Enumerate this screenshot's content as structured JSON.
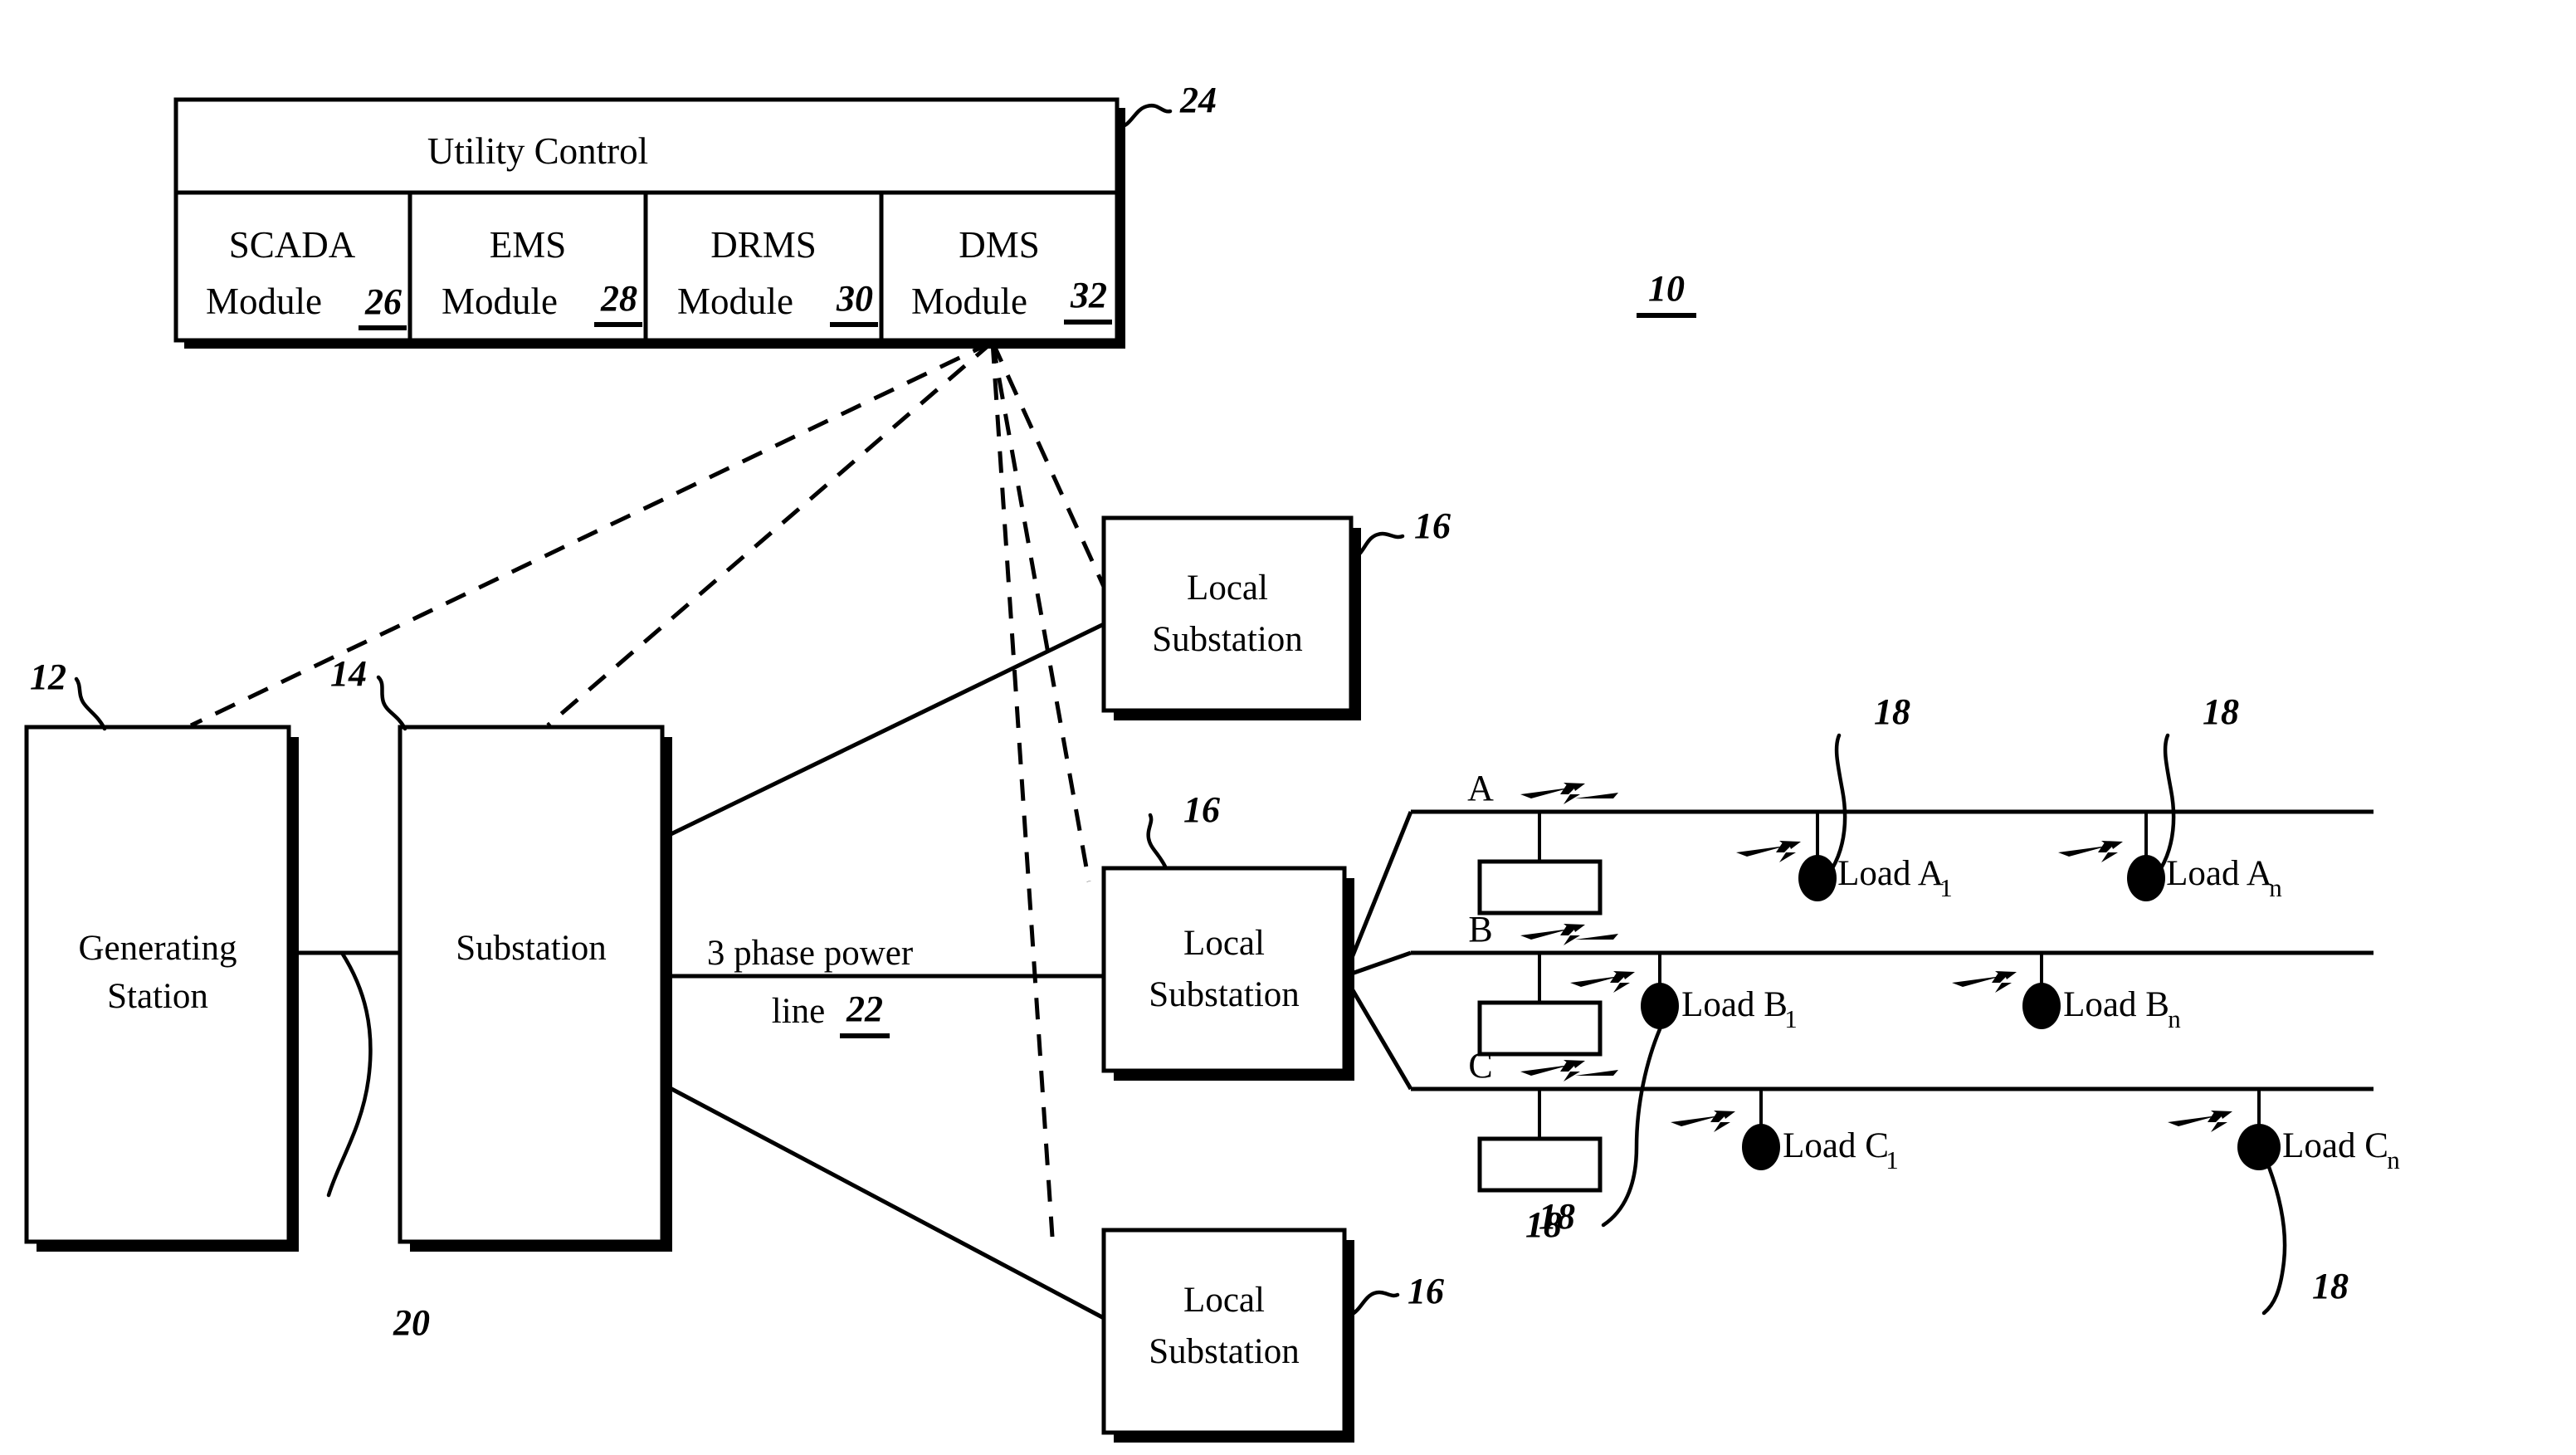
{
  "figure": {
    "figure_number_label": "10",
    "utility_control": {
      "title": "Utility Control",
      "ref": "24",
      "modules": [
        {
          "name": "SCADA",
          "sub": "Module",
          "ref": "26"
        },
        {
          "name": "EMS",
          "sub": "Module",
          "ref": "28"
        },
        {
          "name": "DRMS",
          "sub": "Module",
          "ref": "30"
        },
        {
          "name": "DMS",
          "sub": "Module",
          "ref": "32"
        }
      ]
    },
    "generating_station": {
      "line1": "Generating",
      "line2": "Station",
      "ref": "12"
    },
    "substation": {
      "label": "Substation",
      "ref": "14"
    },
    "interconnect": {
      "ref": "20"
    },
    "power_line": {
      "line1": "3 phase power",
      "line2": "line",
      "ref": "22"
    },
    "local_substations": [
      {
        "line1": "Local",
        "line2": "Substation",
        "ref": "16"
      },
      {
        "line1": "Local",
        "line2": "Substation",
        "ref": "16"
      },
      {
        "line1": "Local",
        "line2": "Substation",
        "ref": "16"
      }
    ],
    "phases": [
      {
        "name": "A",
        "loads": [
          {
            "label": "Load A",
            "subscript": "1",
            "ref": "18"
          },
          {
            "label": "Load A",
            "subscript": "n",
            "ref": "18"
          }
        ]
      },
      {
        "name": "B",
        "loads": [
          {
            "label": "Load B",
            "subscript": "1",
            "ref": "18"
          },
          {
            "label": "Load B",
            "subscript": "n",
            "ref": ""
          }
        ]
      },
      {
        "name": "C",
        "loads": [
          {
            "label": "Load C",
            "subscript": "1",
            "ref": "18"
          },
          {
            "label": "Load C",
            "subscript": "n",
            "ref": "18"
          }
        ]
      }
    ],
    "icons": {
      "bolt": "lightning-bolt-icon",
      "load_dot": "load-node-icon",
      "transformer": "transformer-box-icon"
    },
    "colors": {
      "ink": "#000000",
      "paper": "#ffffff"
    }
  }
}
